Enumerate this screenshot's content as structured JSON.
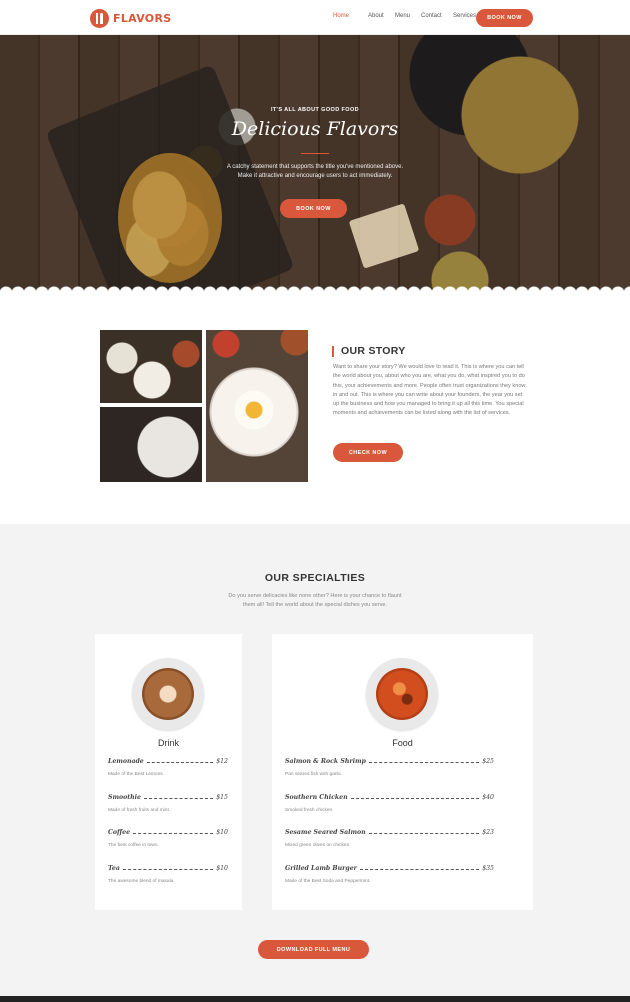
{
  "nav": {
    "logo_text": "FLAVORS",
    "links": [
      "Home",
      "About",
      "Menu",
      "Contact",
      "Services"
    ],
    "active_link": "Home",
    "cta": "BOOK NOW"
  },
  "hero": {
    "kicker": "IT'S ALL ABOUT GOOD FOOD",
    "title": "Delicious Flavors",
    "sub_line1": "A catchy statement that supports the title you've mentioned above.",
    "sub_line2": "Make it attractive and encourage users to act immediately.",
    "cta": "BOOK NOW"
  },
  "story": {
    "heading": "OUR STORY",
    "body": "Want to share your story? We would love to read it. This is where you can tell the world about you, about who you are, what you do, what inspired you to do this, your achievements and more. People often trust organizations they know in and out. This is where you can write about your founders, the year you set up the business and how you managed to bring it up all this time. You special moments and achievements can be listed along with the list of services.",
    "cta": "CHECK NOW"
  },
  "specialties": {
    "heading": "OUR SPECIALTIES",
    "sub_line1": "Do you serve delicacies like none other? Here is your chance to flaunt",
    "sub_line2": "them all! Tell the world about the special dishes you serve.",
    "drink": {
      "title": "Drink",
      "items": [
        {
          "name": "Lemonade",
          "price": "$12",
          "desc": "Made of the Best Lemons."
        },
        {
          "name": "Smoothie",
          "price": "$15",
          "desc": "Made of fresh fruits and mint."
        },
        {
          "name": "Coffee",
          "price": "$10",
          "desc": "The best coffee in town."
        },
        {
          "name": "Tea",
          "price": "$10",
          "desc": "The awesome blend of masala."
        }
      ]
    },
    "food": {
      "title": "Food",
      "items": [
        {
          "name": "Salmon & Rock Shrimp",
          "price": "$25",
          "desc": "Pan seared fish with garlic."
        },
        {
          "name": "Southern Chicken",
          "price": "$40",
          "desc": "Smoked fresh chicken."
        },
        {
          "name": "Sesame Seared Salmon",
          "price": "$23",
          "desc": "Mixed green olives on chicken."
        },
        {
          "name": "Grilled Lamb Burger",
          "price": "$35",
          "desc": "Made of the Best Soda and Peppermint."
        }
      ]
    },
    "cta": "DOWNLOAD FULL MENU"
  },
  "icons": {
    "logo": "fork-knife-icon"
  },
  "colors": {
    "accent": "#d9573a",
    "page_bg": "#f3f3f3"
  }
}
